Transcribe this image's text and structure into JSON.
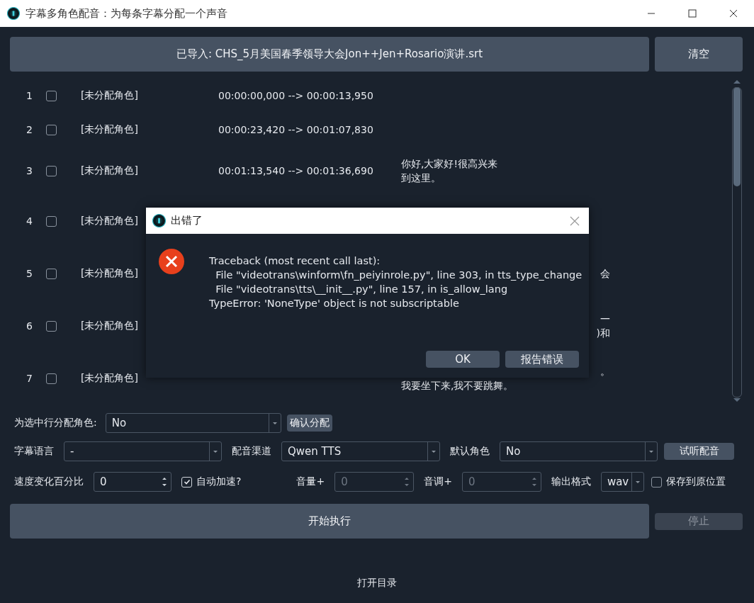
{
  "window": {
    "title": "字幕多角色配音：为每条字幕分配一个声音"
  },
  "import_button": "已导入: CHS_5月美国春季领导大会Jon++Jen+Rosario演讲.srt",
  "clear_button": "清空",
  "rows": [
    {
      "number": "1",
      "checked": false,
      "role": "[未分配角色]",
      "time": "00:00:00,000 --> 00:00:13,950",
      "text": []
    },
    {
      "number": "2",
      "checked": false,
      "role": "[未分配角色]",
      "time": "00:00:23,420 --> 00:01:07,830",
      "text": []
    },
    {
      "number": "3",
      "checked": false,
      "role": "[未分配角色]",
      "time": "00:01:13,540 --> 00:01:36,690",
      "text": [
        "你好,大家好!很高兴来",
        "到这里。"
      ]
    },
    {
      "number": "4",
      "checked": false,
      "role": "[未分配角色]",
      "text": []
    },
    {
      "number": "5",
      "checked": false,
      "role": "[未分配角色]",
      "text": [
        "会"
      ]
    },
    {
      "number": "6",
      "checked": false,
      "role": "[未分配角色]",
      "text": [
        "一",
        ")和"
      ]
    },
    {
      "number": "7",
      "checked": false,
      "role": "[未分配角色]",
      "text": [
        "。",
        "我要坐下来,我不要跳舞。"
      ]
    }
  ],
  "assign": {
    "label": "为选中行分配角色:",
    "value": "No",
    "button": "确认分配"
  },
  "settings_row": [
    {
      "kind": "combo",
      "label": "字幕语言",
      "value": "-"
    },
    {
      "kind": "combo",
      "label": "配音渠道",
      "value": "Qwen TTS"
    },
    {
      "kind": "combo",
      "label": "默认角色",
      "value": "No"
    },
    {
      "kind": "button",
      "label": "试听配音"
    }
  ],
  "options_row": [
    {
      "kind": "spin",
      "label": "速度变化百分比",
      "value": "0",
      "disabled": false
    },
    {
      "kind": "check",
      "label": "自动加速?",
      "checked": true
    },
    {
      "kind": "spin",
      "label": "音量+",
      "value": "0",
      "disabled": true
    },
    {
      "kind": "spin",
      "label": "音调+",
      "value": "0",
      "disabled": true
    },
    {
      "kind": "combo",
      "label": "输出格式",
      "value": "wav"
    },
    {
      "kind": "check",
      "label": "保存到原位置",
      "checked": false
    }
  ],
  "start_button": "开始执行",
  "stop_button": {
    "label": "停止",
    "disabled": true
  },
  "open_folder": "打开目录",
  "dialog": {
    "title": "出错了",
    "message": [
      "Traceback (most recent call last):",
      "  File \"videotrans\\winform\\fn_peiyinrole.py\", line 303, in tts_type_change",
      "  File \"videotrans\\tts\\__init__.py\", line 157, in is_allow_lang",
      "TypeError: 'NoneType' object is not subscriptable"
    ],
    "buttons": [
      "OK",
      "报告错误"
    ]
  }
}
